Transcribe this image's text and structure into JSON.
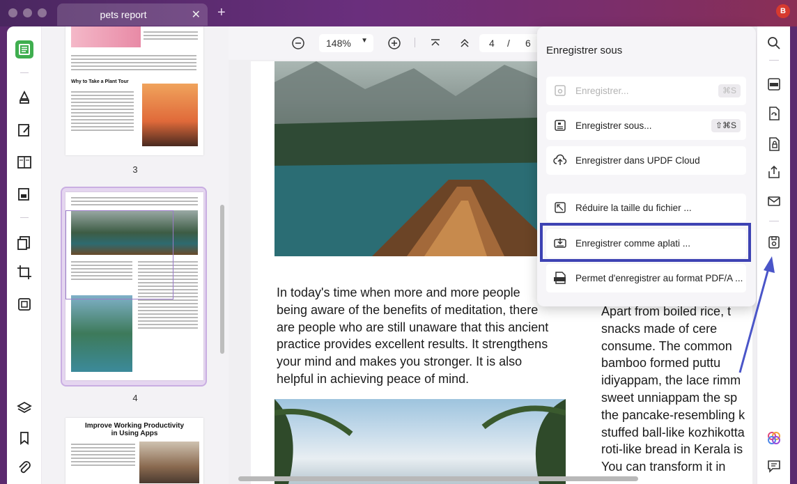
{
  "titlebar": {
    "tab_title": "pets report",
    "tab_close": "✕",
    "new_tab": "+",
    "user_initial": "B"
  },
  "toolbar": {
    "zoom": "148%",
    "current_page": "4",
    "page_separator": "/",
    "total_pages": "6"
  },
  "thumbnails": {
    "page3_number": "3",
    "page4_number": "4",
    "page3_heading": "Why to Take a Plant Tour",
    "page5_title_line1": "Improve Working Productivity",
    "page5_title_line2": "in Using Apps"
  },
  "document": {
    "body_lines": [
      "In today's time when more and more people",
      "being aware of the benefits of meditation, there",
      "are people who are still unaware that this ancient",
      "practice provides excellent results. It strengthens",
      "your mind and makes you stronger. It is also",
      "helpful in achieving peace of mind."
    ],
    "column_lines": [
      "Apart from boiled rice, t",
      "snacks made of cere",
      "consume. The common",
      "bamboo formed puttu",
      "idiyappam, the lace rimm",
      "sweet unniappam the sp",
      "the pancake-resembling k",
      "stuffed ball-like kozhikotta",
      "roti-like bread in Kerala is",
      "You can transform it in"
    ]
  },
  "save_panel": {
    "title": "Enregistrer sous",
    "items": [
      {
        "label": "Enregistrer...",
        "shortcut": "⌘S",
        "disabled": true
      },
      {
        "label": "Enregistrer sous...",
        "shortcut": "⇧⌘S",
        "disabled": false
      },
      {
        "label": "Enregistrer dans UPDF Cloud",
        "shortcut": "",
        "disabled": false
      },
      {
        "label": "Réduire la taille du fichier ...",
        "shortcut": "",
        "disabled": false
      },
      {
        "label": "Enregistrer comme aplati ...",
        "shortcut": "",
        "disabled": false
      },
      {
        "label": "Permet d'enregistrer au format PDF/A ...",
        "shortcut": "",
        "disabled": false
      }
    ]
  },
  "colors": {
    "accent_purple": "#6a2f7d",
    "highlight_blue": "#3d42b3",
    "arrow_blue": "#4a55c8"
  }
}
